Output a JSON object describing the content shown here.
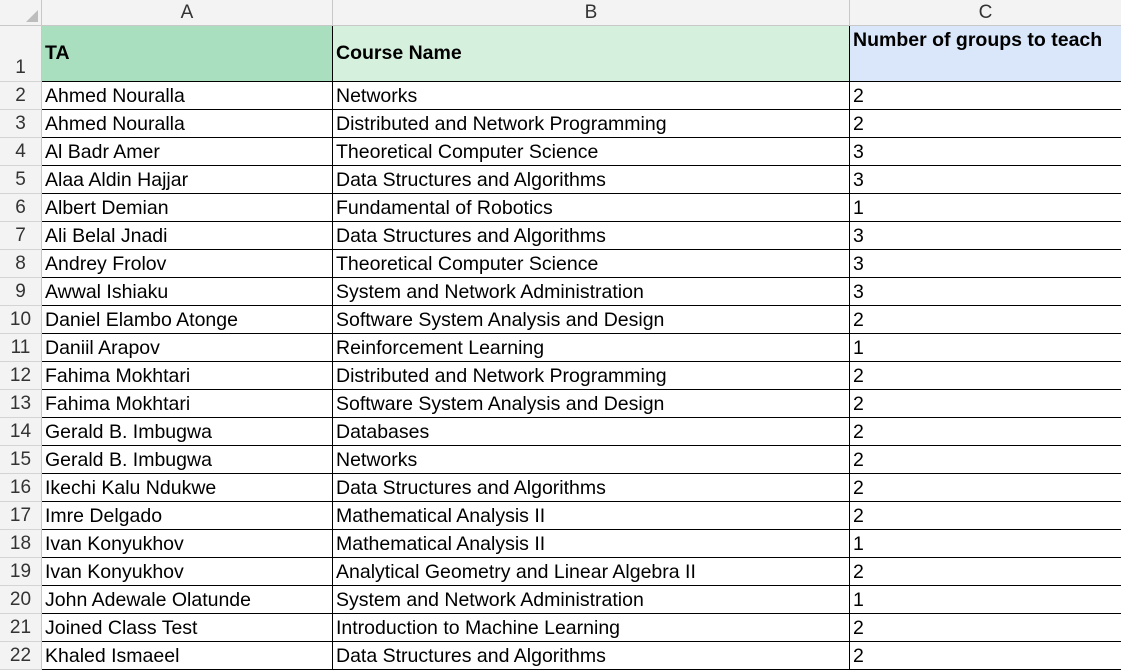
{
  "columns": [
    "A",
    "B",
    "C"
  ],
  "header": {
    "row_num": "1",
    "ta": "TA",
    "course": "Course Name",
    "groups": "Number of groups to teach"
  },
  "rows": [
    {
      "num": "2",
      "ta": "Ahmed Nouralla",
      "course": "Networks",
      "groups": "2"
    },
    {
      "num": "3",
      "ta": "Ahmed Nouralla",
      "course": "Distributed and Network Programming",
      "groups": "2"
    },
    {
      "num": "4",
      "ta": "Al Badr Amer",
      "course": "Theoretical Computer Science",
      "groups": "3"
    },
    {
      "num": "5",
      "ta": "Alaa Aldin Hajjar",
      "course": "Data Structures and Algorithms",
      "groups": "3"
    },
    {
      "num": "6",
      "ta": "Albert Demian",
      "course": "Fundamental of Robotics",
      "groups": "1"
    },
    {
      "num": "7",
      "ta": "Ali Belal Jnadi",
      "course": "Data Structures and Algorithms",
      "groups": "3"
    },
    {
      "num": "8",
      "ta": "Andrey Frolov",
      "course": "Theoretical Computer Science",
      "groups": "3"
    },
    {
      "num": "9",
      "ta": "Awwal Ishiaku",
      "course": "System and Network Administration",
      "groups": "3"
    },
    {
      "num": "10",
      "ta": "Daniel Elambo Atonge",
      "course": "Software System Analysis and Design",
      "groups": "2"
    },
    {
      "num": "11",
      "ta": "Daniil Arapov",
      "course": "Reinforcement Learning",
      "groups": "1"
    },
    {
      "num": "12",
      "ta": "Fahima Mokhtari",
      "course": "Distributed and Network Programming",
      "groups": "2"
    },
    {
      "num": "13",
      "ta": "Fahima Mokhtari",
      "course": "Software System Analysis and Design",
      "groups": "2"
    },
    {
      "num": "14",
      "ta": "Gerald B. Imbugwa",
      "course": "Databases",
      "groups": "2"
    },
    {
      "num": "15",
      "ta": "Gerald B. Imbugwa",
      "course": "Networks",
      "groups": "2"
    },
    {
      "num": "16",
      "ta": "Ikechi Kalu Ndukwe",
      "course": "Data Structures and Algorithms",
      "groups": "2"
    },
    {
      "num": "17",
      "ta": "Imre Delgado",
      "course": "Mathematical Analysis II",
      "groups": "2"
    },
    {
      "num": "18",
      "ta": "Ivan Konyukhov",
      "course": "Mathematical Analysis II",
      "groups": "1"
    },
    {
      "num": "19",
      "ta": "Ivan Konyukhov",
      "course": "Analytical Geometry and Linear Algebra II",
      "groups": "2"
    },
    {
      "num": "20",
      "ta": "John Adewale Olatunde",
      "course": "System and Network Administration",
      "groups": "1"
    },
    {
      "num": "21",
      "ta": "Joined Class Test",
      "course": "Introduction to Machine Learning",
      "groups": "2"
    },
    {
      "num": "22",
      "ta": "Khaled Ismaeel",
      "course": "Data Structures and Algorithms",
      "groups": "2"
    }
  ]
}
